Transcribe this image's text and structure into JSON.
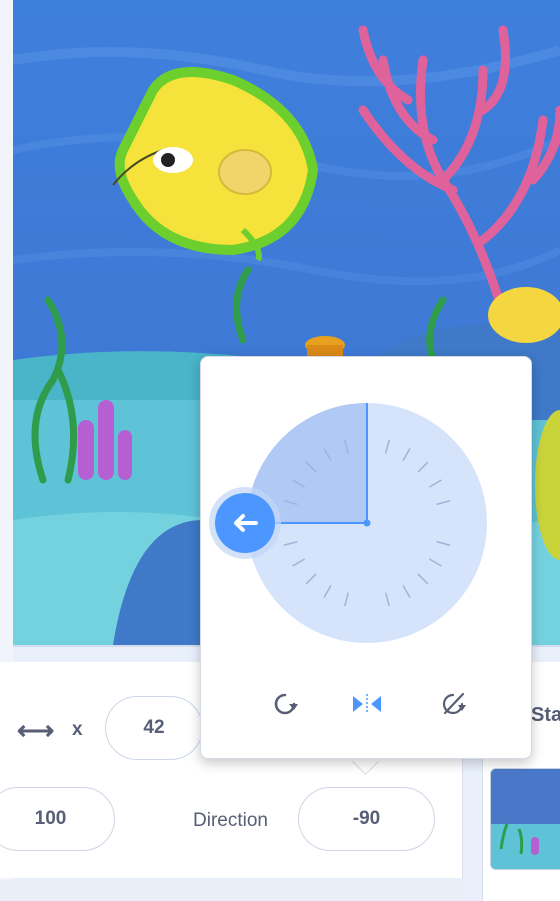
{
  "sprite_info": {
    "x_label": "x",
    "x_value": "42",
    "size_value": "100",
    "direction_label": "Direction",
    "direction_value": "-90"
  },
  "direction_popover": {
    "direction": -90,
    "rotation_styles": [
      "all-around",
      "left-right",
      "dont-rotate"
    ],
    "selected_style": "left-right"
  },
  "stage_pane": {
    "tab_label": "Sta"
  },
  "icons": {
    "x_arrow": "horizontal-double-arrow-icon",
    "all_around": "rotate-all-around-icon",
    "left_right": "left-right-flip-icon",
    "dont_rotate": "dont-rotate-icon",
    "dial_handle": "arrow-left-icon"
  },
  "colors": {
    "accent": "#4c97ff",
    "text": "#575e75",
    "dial_fill": "#d6e4fb",
    "dial_sector": "#b0c9f5"
  }
}
